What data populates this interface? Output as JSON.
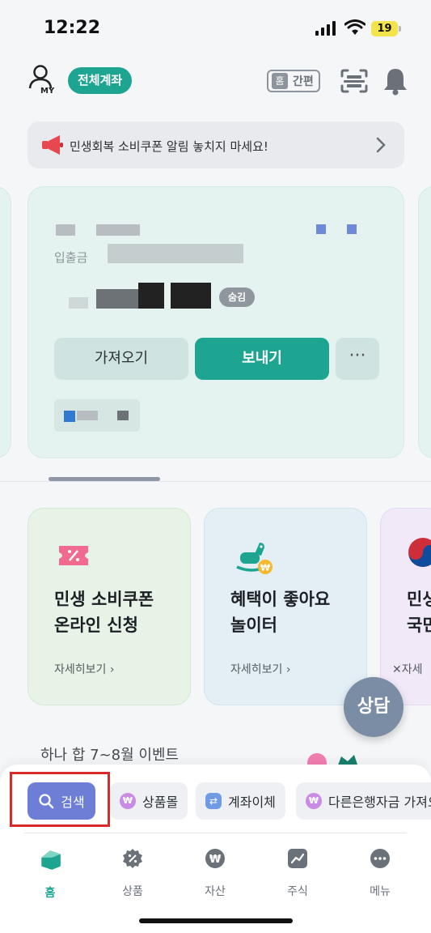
{
  "status_bar": {
    "time": "12:22",
    "battery": "19"
  },
  "header": {
    "my_label": "MY",
    "all_accounts_label": "전체계좌",
    "simple_mode_home": "홈",
    "simple_mode_label": "간편"
  },
  "notice": {
    "text": "민생회복 소비쿠폰 알림 놓치지 마세요!"
  },
  "account_card": {
    "inout_label": "입출금",
    "hide_label": "숨김",
    "fetch_label": "가져오기",
    "send_label": "보내기",
    "more_label": "···"
  },
  "promos": [
    {
      "title_line1": "민생 소비쿠폰",
      "title_line2": "온라인 신청",
      "link": "자세히보기 ›",
      "icon": "coupon-icon"
    },
    {
      "title_line1": "혜택이 좋아요",
      "title_line2": "놀이터",
      "link": "자세히보기 ›",
      "icon": "rocking-horse-icon"
    },
    {
      "title_line1": "민생",
      "title_line2": "국민",
      "link": "✕자세",
      "icon": "taegeuk-icon"
    }
  ],
  "consult_label": "상담",
  "event_text": "하나 합 7~8월 이벤트",
  "chips": {
    "search": "검색",
    "mall": "상품몰",
    "transfer": "계좌이체",
    "other_bank": "다른은행자금 가져오기"
  },
  "tabs": [
    {
      "label": "홈",
      "icon": "home-icon"
    },
    {
      "label": "상품",
      "icon": "product-icon"
    },
    {
      "label": "자산",
      "icon": "asset-icon"
    },
    {
      "label": "주식",
      "icon": "stock-icon"
    },
    {
      "label": "메뉴",
      "icon": "menu-icon"
    }
  ],
  "colors": {
    "brand": "#1ea592",
    "search_chip": "#6e7ed6",
    "highlight": "#d72a2a"
  }
}
